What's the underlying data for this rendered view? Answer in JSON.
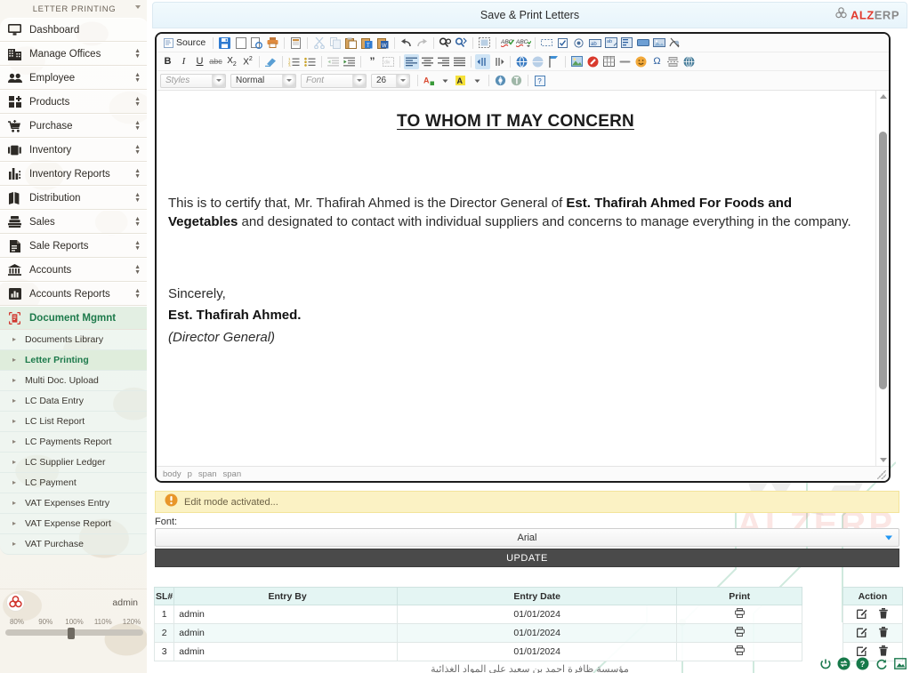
{
  "sidebar": {
    "header_title": "LETTER PRINTING",
    "menu": [
      {
        "label": "Dashboard",
        "icon": "monitor-icon",
        "expandable": false,
        "active": false
      },
      {
        "label": "Manage Offices",
        "icon": "building-icon",
        "expandable": true,
        "active": false
      },
      {
        "label": "Employee",
        "icon": "users-icon",
        "expandable": true,
        "active": false
      },
      {
        "label": "Products",
        "icon": "grid-plus-icon",
        "expandable": true,
        "active": false
      },
      {
        "label": "Purchase",
        "icon": "cart-icon",
        "expandable": true,
        "active": false
      },
      {
        "label": "Inventory",
        "icon": "boxes-icon",
        "expandable": true,
        "active": false
      },
      {
        "label": "Inventory Reports",
        "icon": "bar-chart-icon",
        "expandable": true,
        "active": false
      },
      {
        "label": "Distribution",
        "icon": "map-icon",
        "expandable": true,
        "active": false
      },
      {
        "label": "Sales",
        "icon": "register-icon",
        "expandable": true,
        "active": false
      },
      {
        "label": "Sale Reports",
        "icon": "document-icon",
        "expandable": true,
        "active": false
      },
      {
        "label": "Accounts",
        "icon": "bank-icon",
        "expandable": true,
        "active": false
      },
      {
        "label": "Accounts Reports",
        "icon": "chart-report-icon",
        "expandable": true,
        "active": false
      },
      {
        "label": "Document Mgmnt",
        "icon": "scan-document-icon",
        "expandable": false,
        "active": true
      }
    ],
    "submenu": [
      {
        "label": "Documents Library",
        "active": false
      },
      {
        "label": "Letter Printing",
        "active": true
      },
      {
        "label": "Multi Doc. Upload",
        "active": false
      },
      {
        "label": "LC Data Entry",
        "active": false
      },
      {
        "label": "LC List Report",
        "active": false
      },
      {
        "label": "LC Payments Report",
        "active": false
      },
      {
        "label": "LC Supplier Ledger",
        "active": false
      },
      {
        "label": "LC Payment",
        "active": false
      },
      {
        "label": "VAT Expenses Entry",
        "active": false
      },
      {
        "label": "VAT Expense Report",
        "active": false
      },
      {
        "label": "VAT Purchase",
        "active": false
      }
    ],
    "user_name": "admin",
    "zoom_steps": [
      "80%",
      "90%",
      "100%",
      "110%",
      "120%"
    ],
    "zoom_current": "100%"
  },
  "header": {
    "title": "Save & Print Letters",
    "brand_primary": "ALZ",
    "brand_secondary": "ERP",
    "brand_primary_color": "#e23b2e",
    "brand_secondary_color": "#8a8a8a"
  },
  "editor": {
    "source_label": "Source",
    "combos": {
      "styles": "Styles",
      "paragraph_format": "Normal",
      "font": "Font",
      "size": "26"
    },
    "document": {
      "title": "TO WHOM IT MAY CONCERN",
      "body_part1": "This is to certify that, Mr. Thafirah Ahmed is the Director General of ",
      "body_bold1": "Est. Thafirah Ahmed For Foods and Vegetables",
      "body_part2": " and designated to contact with individual suppliers and concerns to manage everything in the company.",
      "closing": "Sincerely,",
      "signer": "Est. Thafirah Ahmed.",
      "signer_role": "(Director General)"
    },
    "element_path": [
      "body",
      "p",
      "span",
      "span"
    ]
  },
  "alert": {
    "message": "Edit mode activated...",
    "icon": "warning-icon",
    "background_color": "#fbf2c4"
  },
  "form": {
    "font_label": "Font:",
    "font_value": "Arial",
    "update_label": "UPDATE"
  },
  "table": {
    "columns": [
      "SL#",
      "Entry By",
      "Entry Date",
      "Print",
      "Action"
    ],
    "rows": [
      {
        "sl": "1",
        "entry_by": "admin",
        "entry_date": "01/01/2024",
        "print": "printer-icon"
      },
      {
        "sl": "2",
        "entry_by": "admin",
        "entry_date": "01/01/2024",
        "print": "printer-icon"
      },
      {
        "sl": "3",
        "entry_by": "admin",
        "entry_date": "01/01/2024",
        "print": "printer-icon"
      }
    ]
  },
  "footer": {
    "arabic_text": "مؤسسة ظافرة احمد بن سعيد على المواد الغذائية"
  },
  "fabs": [
    {
      "name": "power-icon"
    },
    {
      "name": "sync-icon"
    },
    {
      "name": "help-icon"
    },
    {
      "name": "refresh-icon"
    },
    {
      "name": "image-icon"
    }
  ],
  "watermark": {
    "text": "ALZERP"
  }
}
